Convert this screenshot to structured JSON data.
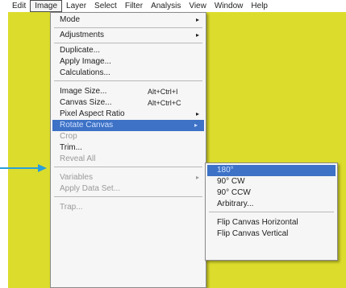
{
  "menubar": [
    "Edit",
    "Image",
    "Layer",
    "Select",
    "Filter",
    "Analysis",
    "View",
    "Window",
    "Help"
  ],
  "image_menu": {
    "mode": "Mode",
    "adjustments": "Adjustments",
    "duplicate": "Duplicate...",
    "apply_image": "Apply Image...",
    "calculations": "Calculations...",
    "image_size": "Image Size...",
    "image_size_shortcut": "Alt+Ctrl+I",
    "canvas_size": "Canvas Size...",
    "canvas_size_shortcut": "Alt+Ctrl+C",
    "pixel_aspect_ratio": "Pixel Aspect Ratio",
    "rotate_canvas": "Rotate Canvas",
    "crop": "Crop",
    "trim": "Trim...",
    "reveal_all": "Reveal All",
    "variables": "Variables",
    "apply_data_set": "Apply Data Set...",
    "trap": "Trap..."
  },
  "rotate_submenu": {
    "r180": "180°",
    "cw90": "90° CW",
    "ccw90": "90° CCW",
    "arbitrary": "Arbitrary...",
    "flip_h": "Flip Canvas Horizontal",
    "flip_v": "Flip Canvas Vertical"
  },
  "icons": {
    "submenu_arrow": "▸",
    "pointer": "arrow-pointer-icon"
  },
  "colors": {
    "canvas": "#dcdc2c",
    "highlight": "#3d72c6",
    "pointer": "#2a9fd8"
  }
}
